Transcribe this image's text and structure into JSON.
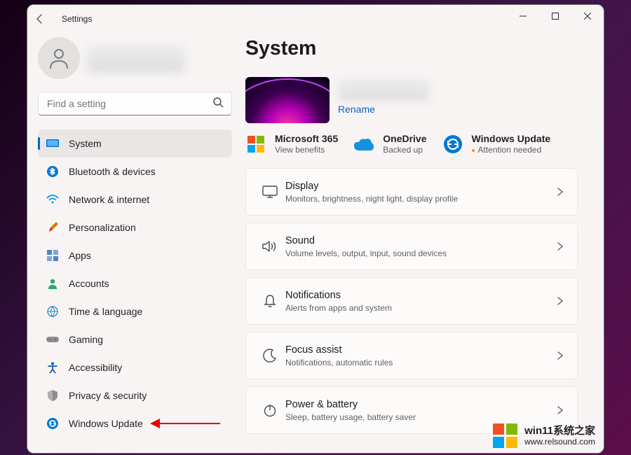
{
  "titlebar": {
    "title": "Settings"
  },
  "search": {
    "placeholder": "Find a setting"
  },
  "nav": [
    {
      "label": "System",
      "icon": "system",
      "active": true
    },
    {
      "label": "Bluetooth & devices",
      "icon": "bluetooth"
    },
    {
      "label": "Network & internet",
      "icon": "wifi"
    },
    {
      "label": "Personalization",
      "icon": "brush"
    },
    {
      "label": "Apps",
      "icon": "apps"
    },
    {
      "label": "Accounts",
      "icon": "person"
    },
    {
      "label": "Time & language",
      "icon": "globe"
    },
    {
      "label": "Gaming",
      "icon": "gamepad"
    },
    {
      "label": "Accessibility",
      "icon": "accessibility"
    },
    {
      "label": "Privacy & security",
      "icon": "shield"
    },
    {
      "label": "Windows Update",
      "icon": "update"
    }
  ],
  "main": {
    "heading": "System",
    "rename": "Rename",
    "services": [
      {
        "title": "Microsoft 365",
        "sub": "View benefits",
        "icon": "ms365"
      },
      {
        "title": "OneDrive",
        "sub": "Backed up",
        "icon": "onedrive"
      },
      {
        "title": "Windows Update",
        "sub": "Attention needed",
        "icon": "update-ring",
        "attention": true
      }
    ],
    "cards": [
      {
        "title": "Display",
        "sub": "Monitors, brightness, night light, display profile",
        "icon": "display"
      },
      {
        "title": "Sound",
        "sub": "Volume levels, output, input, sound devices",
        "icon": "sound"
      },
      {
        "title": "Notifications",
        "sub": "Alerts from apps and system",
        "icon": "bell"
      },
      {
        "title": "Focus assist",
        "sub": "Notifications, automatic rules",
        "icon": "moon"
      },
      {
        "title": "Power & battery",
        "sub": "Sleep, battery usage, battery saver",
        "icon": "power"
      }
    ]
  },
  "watermark": {
    "text": "win11系统之家",
    "sub": "www.relsound.com"
  },
  "icons": {
    "system": "<svg width='18' height='14' viewBox='0 0 18 14'><rect x='0' y='1' width='18' height='11' rx='1' fill='#0078d4'/><rect x='1.5' y='2.5' width='15' height='8' fill='#5cb3ff'/></svg>",
    "bluetooth": "<svg width='16' height='16' viewBox='0 0 16 16'><circle cx='8' cy='8' r='8' fill='#0078d4'/><path d='M7 3 L11 6 L7 9 L7 3 M7 13 L11 10 L7 7 L7 13 M4 5 L10 11 M4 11 L10 5' stroke='white' stroke-width='1.3' fill='none'/></svg>",
    "wifi": "<svg width='18' height='14' viewBox='0 0 18 14'><path d='M1 5 Q9 -3 17 5' stroke='#1ba0e1' stroke-width='2' fill='none'/><path d='M4 8 Q9 3 14 8' stroke='#1ba0e1' stroke-width='2' fill='none'/><circle cx='9' cy='11' r='1.6' fill='#1ba0e1'/></svg>",
    "brush": "<svg width='16' height='16' viewBox='0 0 16 16'><path d='M3 14 L5 8 L13 0 L16 3 L8 11 L3 14' fill='#d97a00'/><path d='M3 14 L5 8 L8 11 Z' fill='#e01b24'/></svg>",
    "apps": "<svg width='16' height='16' viewBox='0 0 16 16'><rect x='0' y='0' width='7' height='7' fill='#4f83cc'/><rect x='9' y='0' width='7' height='7' fill='#79a8de'/><rect x='0' y='9' width='7' height='7' fill='#79a8de'/><rect x='9' y='9' width='7' height='7' fill='#4f83cc'/></svg>",
    "person": "<svg width='16' height='16' viewBox='0 0 16 16'><circle cx='8' cy='5' r='3.2' fill='#2aa876'/><path d='M2 16 Q2 10 8 10 Q14 10 14 16 Z' fill='#2aa876'/></svg>",
    "globe": "<svg width='16' height='16' viewBox='0 0 16 16'><circle cx='8' cy='8' r='7' fill='#fff' stroke='#2179b8' stroke-width='1.2'/><path d='M1 8 H15 M8 1 Q3 8 8 15 M8 1 Q13 8 8 15' stroke='#2179b8' stroke-width='1' fill='none'/></svg>",
    "gamepad": "<svg width='18' height='12' viewBox='0 0 18 12'><rect x='0' y='2' width='18' height='8' rx='4' fill='#8d8d8d'/><circle cx='5' cy='6' r='1' fill='#555'/><circle cx='13' cy='6' r='1' fill='#555'/></svg>",
    "accessibility": "<svg width='16' height='16' viewBox='0 0 16 16'><circle cx='8' cy='2.5' r='2' fill='#0c59b3'/><path d='M2 6 L14 6 M8 6 L8 11 M8 11 L4 16 M8 11 L12 16' stroke='#0c59b3' stroke-width='1.8' fill='none' stroke-linecap='round'/></svg>",
    "shield": "<svg width='14' height='16' viewBox='0 0 14 16'><path d='M7 0 L14 3 V8 Q14 14 7 16 Q0 14 0 8 V3 Z' fill='#b0b0b0'/><path d='M7 0 L14 3 V8 Q14 14 7 16 V0' fill='#8e8e8e'/></svg>",
    "update": "<svg width='16' height='16' viewBox='0 0 16 16'><circle cx='8' cy='8' r='8' fill='#0078d4'/><path d='M4 8 A4 4 0 1 1 5.2 11 M12 8 A4 4 0 1 1 10.8 5' stroke='white' stroke-width='1.4' fill='none'/><path d='M4 5 L4 8 L7 8 M12 11 L12 8 L9 8' stroke='white' stroke-width='1.4' fill='none'/></svg>",
    "ms365": "<svg width='28' height='28' viewBox='0 0 28 28'><rect x='2' y='2' width='11' height='11' fill='#f25022'/><rect x='15' y='2' width='11' height='11' fill='#7fba00'/><rect x='2' y='15' width='11' height='11' fill='#00a4ef'/><rect x='15' y='15' width='11' height='11' fill='#ffb900'/></svg>",
    "onedrive": "<svg width='28' height='18' viewBox='0 0 28 18'><path d='M7 18 Q0 18 0 11 Q0 5 7 6 Q9 0 16 2 Q23 -1 25 7 Q28 8 28 13 Q28 18 22 18 Z' fill='#1490df'/></svg>",
    "update-ring": "<svg width='28' height='28' viewBox='0 0 28 28'><circle cx='14' cy='14' r='13' fill='#0078d4'/><path d='M7 14 A7 7 0 1 1 9 19 M21 14 A7 7 0 1 1 19 9' stroke='white' stroke-width='2' fill='none'/><path d='M7 9 L7 14 L12 14 M21 19 L21 14 L16 14' stroke='white' stroke-width='2' fill='none'/></svg>",
    "display": "<svg width='22' height='18' viewBox='0 0 22 18'><rect x='1' y='1' width='20' height='13' rx='1.5' stroke='#4a4a4a' stroke-width='1.4' fill='none'/><line x1='7' y1='17' x2='15' y2='17' stroke='#4a4a4a' stroke-width='1.4'/><line x1='11' y1='14' x2='11' y2='17' stroke='#4a4a4a' stroke-width='1.4'/></svg>",
    "sound": "<svg width='22' height='18' viewBox='0 0 22 18'><path d='M1 6 H5 L10 2 V16 L5 12 H1 Z' stroke='#4a4a4a' stroke-width='1.4' fill='none' stroke-linejoin='round'/><path d='M13 5 Q16 9 13 13 M16 3 Q21 9 16 15' stroke='#4a4a4a' stroke-width='1.4' fill='none'/></svg>",
    "bell": "<svg width='18' height='20' viewBox='0 0 18 20'><path d='M9 2 Q14 2 14 9 L14 13 L16 15 H2 L4 13 L4 9 Q4 2 9 2 Z' stroke='#4a4a4a' stroke-width='1.4' fill='none'/><path d='M7 17 Q9 20 11 17' stroke='#4a4a4a' stroke-width='1.4' fill='none'/></svg>",
    "moon": "<svg width='20' height='20' viewBox='0 0 20 20'><path d='M14 2 A9 9 0 1 0 18 14 A7 7 0 0 1 14 2 Z' stroke='#4a4a4a' stroke-width='1.4' fill='none'/></svg>",
    "power": "<svg width='20' height='20' viewBox='0 0 20 20'><circle cx='10' cy='11' r='7.5' stroke='#4a4a4a' stroke-width='1.4' fill='none'/><line x1='10' y1='2' x2='10' y2='10' stroke='#4a4a4a' stroke-width='1.4'/></svg>"
  },
  "colors": {
    "accent": "#0067c0"
  }
}
